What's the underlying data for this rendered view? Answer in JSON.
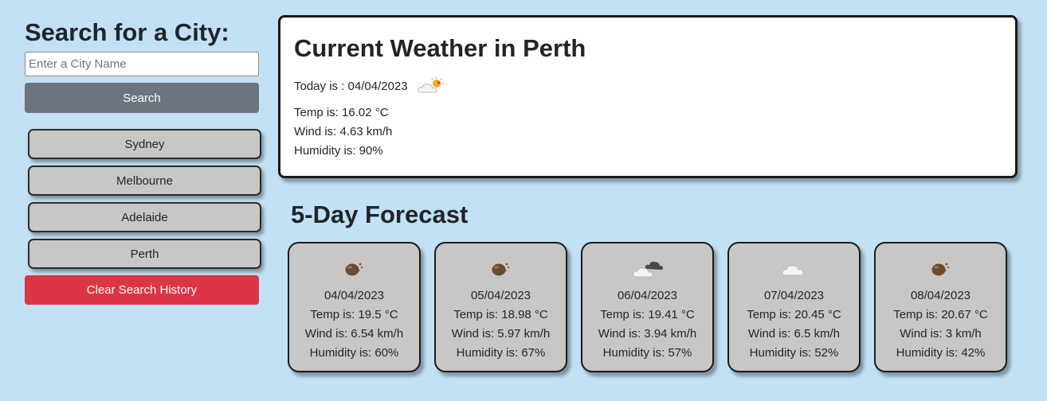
{
  "sidebar": {
    "title": "Search for a City:",
    "input_placeholder": "Enter a City Name",
    "input_value": "",
    "search_label": "Search",
    "history": [
      "Sydney",
      "Melbourne",
      "Adelaide",
      "Perth"
    ],
    "clear_label": "Clear Search History"
  },
  "current": {
    "title": "Current Weather in Perth",
    "today": "Today is : 04/04/2023",
    "icon": "sun-behind-cloud-icon",
    "temp": "Temp is: 16.02 °C",
    "wind": "Wind is: 4.63 km/h",
    "humidity": "Humidity is: 90%"
  },
  "forecast": {
    "title": "5-Day Forecast",
    "days": [
      {
        "icon": "rain-drops-icon",
        "date": "04/04/2023",
        "temp": "Temp is: 19.5 °C",
        "wind": "Wind is: 6.54 km/h",
        "humidity": "Humidity is: 60%"
      },
      {
        "icon": "rain-drops-icon",
        "date": "05/04/2023",
        "temp": "Temp is: 18.98 °C",
        "wind": "Wind is: 5.97 km/h",
        "humidity": "Humidity is: 67%"
      },
      {
        "icon": "dark-clouds-icon",
        "date": "06/04/2023",
        "temp": "Temp is: 19.41 °C",
        "wind": "Wind is: 3.94 km/h",
        "humidity": "Humidity is: 57%"
      },
      {
        "icon": "cloud-icon",
        "date": "07/04/2023",
        "temp": "Temp is: 20.45 °C",
        "wind": "Wind is: 6.5 km/h",
        "humidity": "Humidity is: 52%"
      },
      {
        "icon": "rain-drops-icon",
        "date": "08/04/2023",
        "temp": "Temp is: 20.67 °C",
        "wind": "Wind is: 3 km/h",
        "humidity": "Humidity is: 42%"
      }
    ]
  },
  "colors": {
    "background": "#c2e1f5",
    "search_button": "#6c757d",
    "clear_button": "#dc3545",
    "card_background": "#c9c7c6"
  }
}
